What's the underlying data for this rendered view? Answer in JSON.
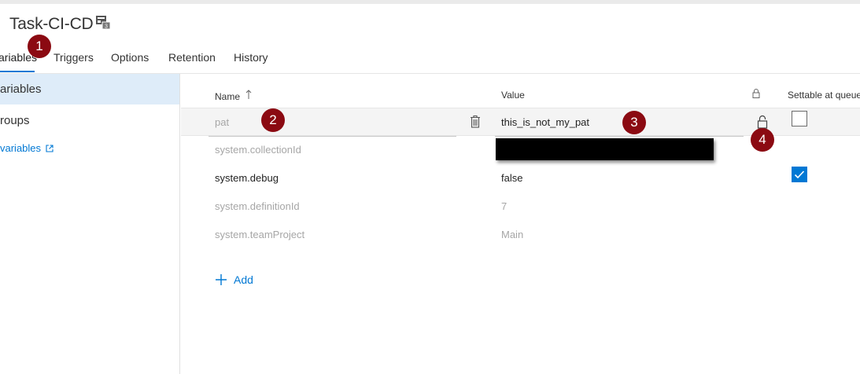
{
  "header": {
    "title": "Task-CI-CD"
  },
  "tabs": [
    {
      "label": "ariables"
    },
    {
      "label": "Triggers"
    },
    {
      "label": "Options"
    },
    {
      "label": "Retention"
    },
    {
      "label": "History"
    }
  ],
  "sidebar": {
    "items": [
      {
        "label": "ariables"
      },
      {
        "label": "roups"
      }
    ],
    "link": {
      "label": "variables"
    }
  },
  "table": {
    "columns": {
      "name": "Name",
      "value": "Value",
      "settable": "Settable at queue"
    },
    "rows": [
      {
        "name": "pat",
        "value": "this_is_not_my_pat",
        "settable": false
      },
      {
        "name": "system.collectionId",
        "value": ""
      },
      {
        "name": "system.debug",
        "value": "false",
        "settable": true
      },
      {
        "name": "system.definitionId",
        "value": "7"
      },
      {
        "name": "system.teamProject",
        "value": "Main"
      }
    ],
    "add_label": "Add"
  },
  "markers": [
    "1",
    "2",
    "3",
    "4"
  ],
  "colors": {
    "accent": "#0078d4",
    "selected_bg": "#deecf9",
    "marker": "#8b0a12"
  },
  "icons": {
    "title": "build-definition-icon",
    "sort": "sort-ascending-icon",
    "lock": "lock-icon",
    "delete": "trash-icon",
    "add": "plus-icon",
    "external": "external-link-icon"
  }
}
